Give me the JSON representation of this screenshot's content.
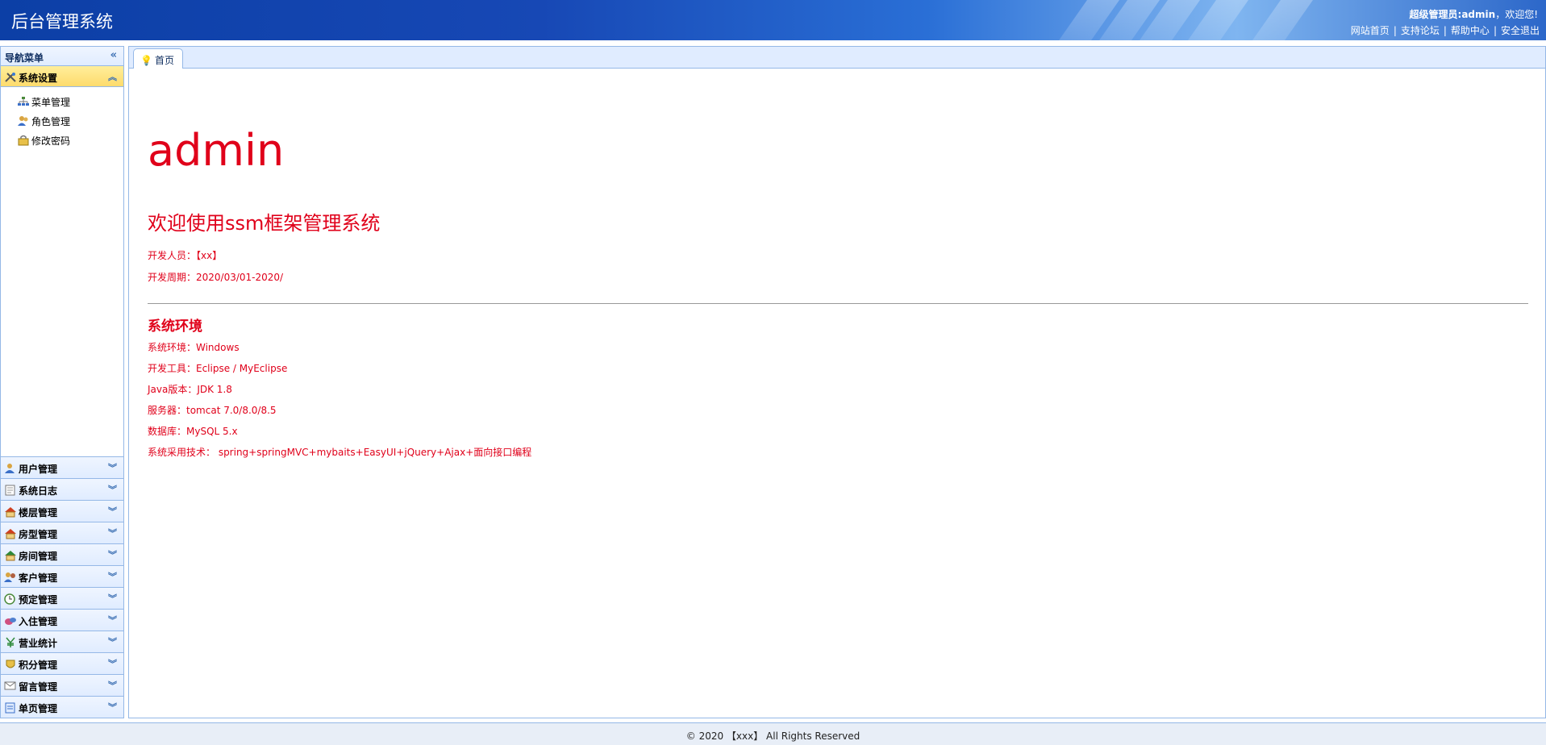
{
  "header": {
    "title": "后台管理系统",
    "welcome_user": "超级管理员:admin",
    "welcome_suffix": "，欢迎您!",
    "links": [
      "网站首页",
      "支持论坛",
      "帮助中心",
      "安全退出"
    ]
  },
  "sidebar": {
    "nav_title": "导航菜单",
    "active_section": {
      "label": "系统设置",
      "icon": "tools-icon",
      "items": [
        {
          "label": "菜单管理",
          "icon": "menu-tree-icon"
        },
        {
          "label": "角色管理",
          "icon": "role-users-icon"
        },
        {
          "label": "修改密码",
          "icon": "password-lock-icon"
        }
      ]
    },
    "sections": [
      {
        "label": "用户管理",
        "icon": "user-icon"
      },
      {
        "label": "系统日志",
        "icon": "log-icon"
      },
      {
        "label": "楼层管理",
        "icon": "house-icon"
      },
      {
        "label": "房型管理",
        "icon": "house-icon"
      },
      {
        "label": "房间管理",
        "icon": "house-green-icon"
      },
      {
        "label": "客户管理",
        "icon": "customer-icon"
      },
      {
        "label": "预定管理",
        "icon": "clock-icon"
      },
      {
        "label": "入住管理",
        "icon": "checkin-icon"
      },
      {
        "label": "营业统计",
        "icon": "yen-icon"
      },
      {
        "label": "积分管理",
        "icon": "points-icon"
      },
      {
        "label": "留言管理",
        "icon": "message-icon"
      },
      {
        "label": "单页管理",
        "icon": "page-icon"
      }
    ]
  },
  "tabs": [
    {
      "label": "首页",
      "icon": "bulb-icon"
    }
  ],
  "main": {
    "username": "admin",
    "welcome": "欢迎使用ssm框架管理系统",
    "developer": "开发人员：【xx】",
    "period": "开发周期：2020/03/01-2020/",
    "env_title": "系统环境",
    "env_items": [
      "系统环境：Windows",
      "开发工具：Eclipse / MyEclipse",
      "Java版本：JDK 1.8",
      "服务器：tomcat 7.0/8.0/8.5",
      "数据库：MySQL 5.x",
      "系统采用技术： spring+springMVC+mybaits+EasyUI+jQuery+Ajax+面向接口编程"
    ]
  },
  "footer": {
    "text": "© 2020 【xxx】 All Rights Reserved"
  }
}
